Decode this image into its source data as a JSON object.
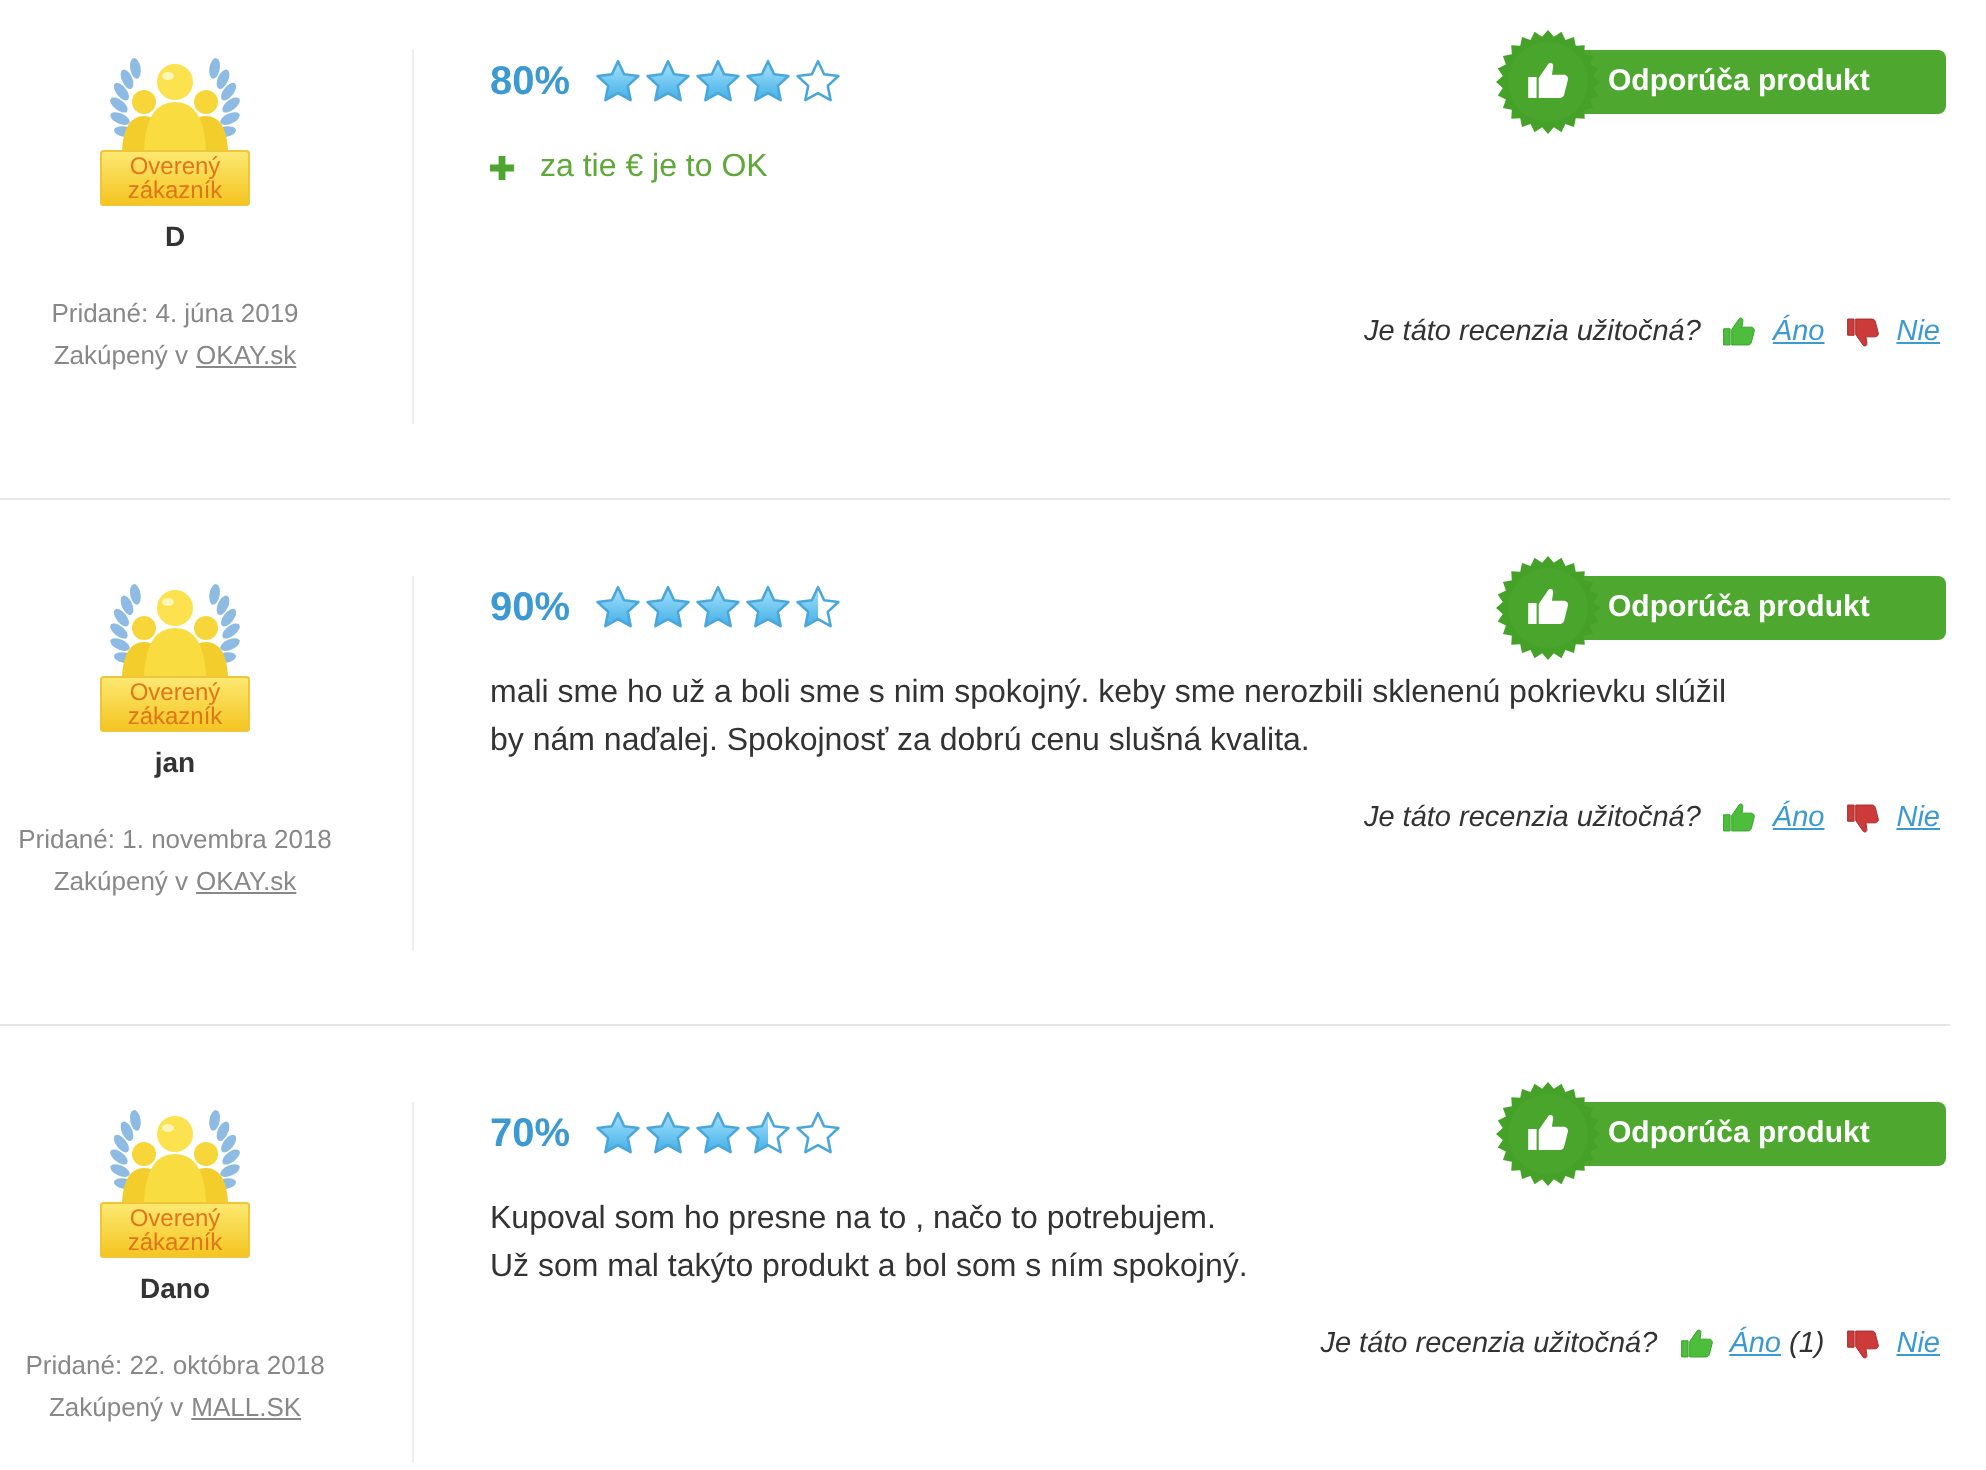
{
  "reviews": [
    {
      "reviewer": {
        "badge": "Overený zákazník",
        "name": "D",
        "added": "Pridané: 4. júna 2019",
        "purchased_label": "Zakúpený v",
        "shop": "OKAY.sk"
      },
      "rating": "80%",
      "stars": 4,
      "recommend": "Odporúča produkt",
      "pros": [
        "za tie € je to OK"
      ],
      "helpful": {
        "question": "Je táto recenzia užitočná?",
        "yes": "Áno",
        "no": "Nie"
      }
    },
    {
      "reviewer": {
        "badge": "Overený zákazník",
        "name": "jan",
        "added": "Pridané: 1. novembra 2018",
        "purchased_label": "Zakúpený v",
        "shop": "OKAY.sk"
      },
      "rating": "90%",
      "stars": 4.5,
      "recommend": "Odporúča produkt",
      "comment": [
        "mali sme ho už a boli sme s nim spokojný. keby sme nerozbili sklenenú pokrievku slúžil by nám naďalej. Spokojnosť za dobrú cenu slušná kvalita."
      ],
      "helpful": {
        "question": "Je táto recenzia užitočná?",
        "yes": "Áno",
        "no": "Nie"
      }
    },
    {
      "reviewer": {
        "badge": "Overený zákazník",
        "name": "Dano",
        "added": "Pridané: 22. októbra 2018",
        "purchased_label": "Zakúpený v",
        "shop": "MALL.SK"
      },
      "rating": "70%",
      "stars": 3.5,
      "recommend": "Odporúča produkt",
      "comment": [
        "Kupoval som ho presne na to , načo to potrebujem.",
        "Už som mal takýto produkt a bol som s ním spokojný."
      ],
      "helpful": {
        "question": "Je táto recenzia užitočná?",
        "yes": "Áno",
        "yes_count": "(1)",
        "no": "Nie"
      }
    }
  ]
}
